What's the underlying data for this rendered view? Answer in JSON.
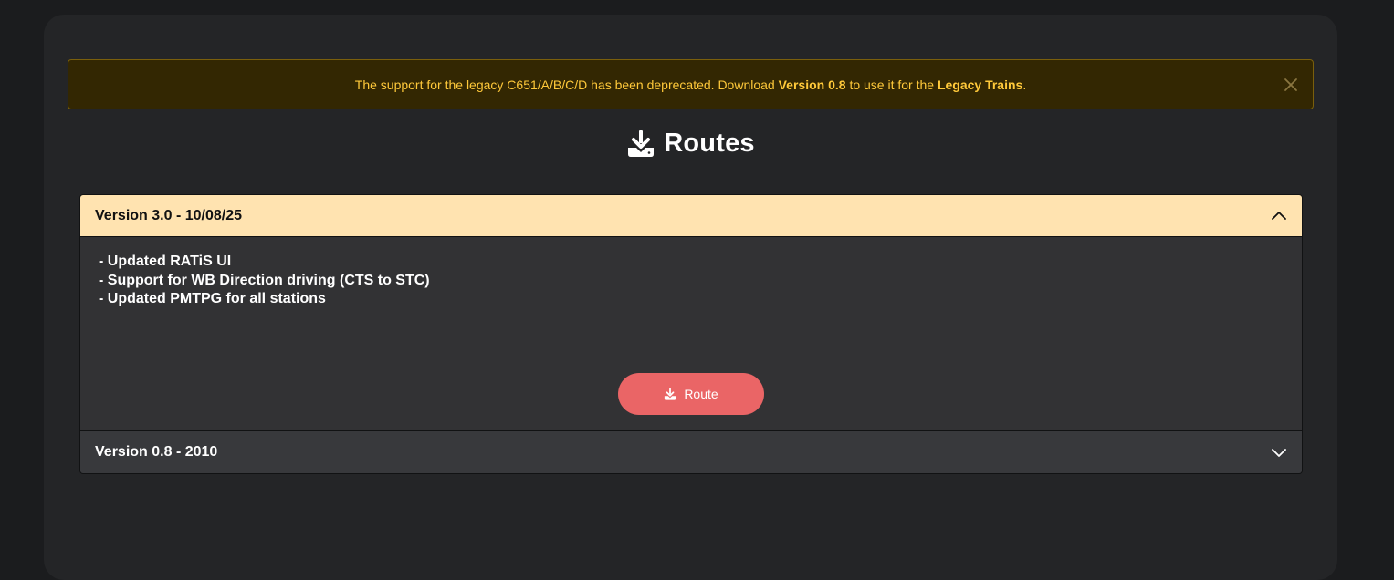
{
  "alert": {
    "text_before": "The support for the legacy C651/A/B/C/D has been deprecated. Download",
    "version_link": "Version 0.8",
    "text_middle": "to use it for the",
    "legacy_link": "Legacy Trains",
    "text_end": ".",
    "close_icon": "close-icon",
    "color": "#ffc93a"
  },
  "page": {
    "title": "Routes",
    "title_icon": "download-icon"
  },
  "accordion": [
    {
      "header": "Version 3.0 - 10/08/25",
      "expanded": true,
      "notes": [
        "- Updated RATiS UI",
        "- Support for WB Direction driving (CTS to STC)",
        "- Updated PMTPG for all stations"
      ],
      "button_label": "Route",
      "button_icon": "download-icon",
      "header_color": "#ffe3b0",
      "button_color": "#ea6566"
    },
    {
      "header": "Version 0.8 - 2010",
      "expanded": false
    }
  ]
}
